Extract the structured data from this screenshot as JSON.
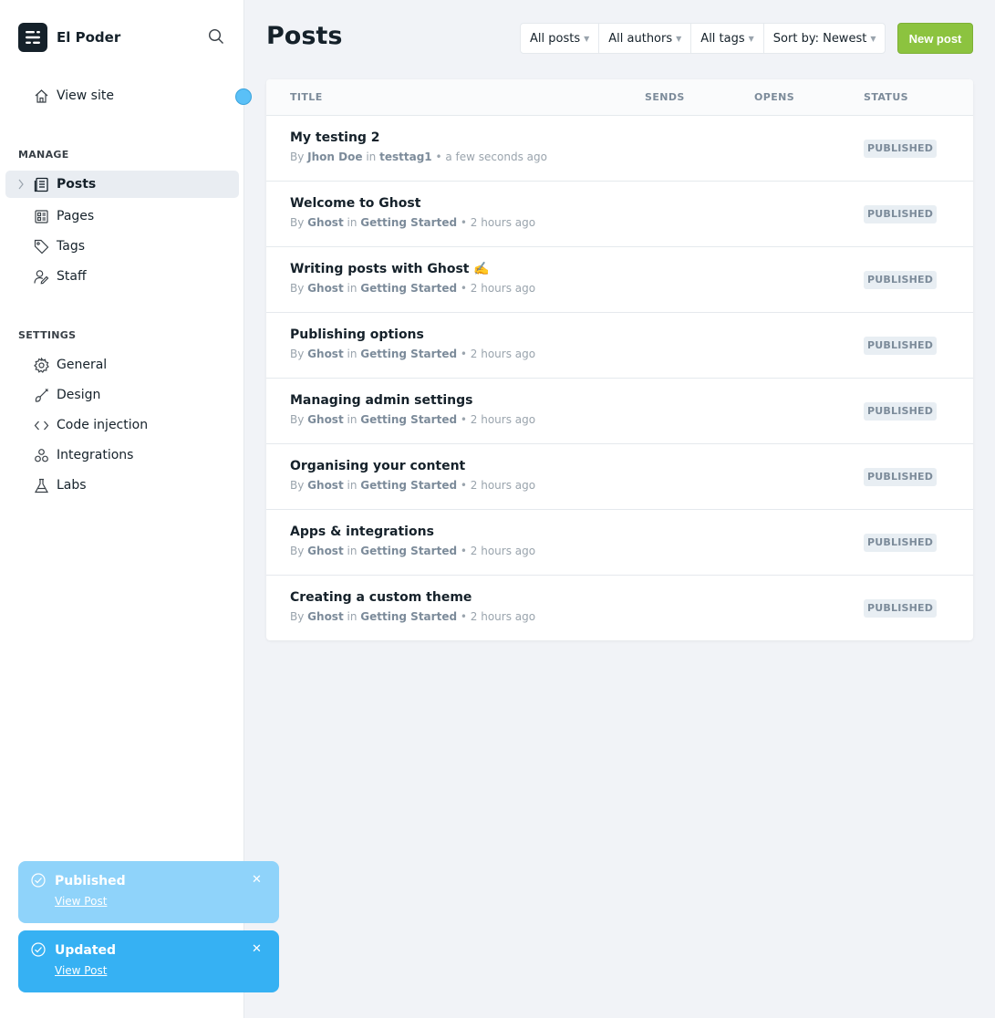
{
  "brand": {
    "name": "El Poder"
  },
  "sidebar": {
    "view_site": "View site",
    "manage_title": "MANAGE",
    "manage": [
      {
        "label": "Posts",
        "icon": "posts-icon",
        "active": true
      },
      {
        "label": "Pages",
        "icon": "pages-icon"
      },
      {
        "label": "Tags",
        "icon": "tag-icon"
      },
      {
        "label": "Staff",
        "icon": "staff-icon"
      }
    ],
    "settings_title": "SETTINGS",
    "settings": [
      {
        "label": "General",
        "icon": "gear-icon"
      },
      {
        "label": "Design",
        "icon": "brush-icon"
      },
      {
        "label": "Code injection",
        "icon": "code-icon"
      },
      {
        "label": "Integrations",
        "icon": "integrations-icon"
      },
      {
        "label": "Labs",
        "icon": "flask-icon"
      }
    ]
  },
  "header": {
    "title": "Posts",
    "filters": [
      "All posts",
      "All authors",
      "All tags",
      "Sort by: Newest"
    ],
    "new_post": "New post"
  },
  "table": {
    "columns": [
      "TITLE",
      "SENDS",
      "OPENS",
      "STATUS"
    ],
    "rows": [
      {
        "title": "My testing 2",
        "by": "By",
        "author": "Jhon Doe",
        "in": "in",
        "tag": "testtag1",
        "time": "• a few seconds ago",
        "status": "PUBLISHED"
      },
      {
        "title": "Welcome to Ghost",
        "by": "By",
        "author": "Ghost",
        "in": "in",
        "tag": "Getting Started",
        "time": "• 2 hours ago",
        "status": "PUBLISHED"
      },
      {
        "title": "Writing posts with Ghost ✍️",
        "by": "By",
        "author": "Ghost",
        "in": "in",
        "tag": "Getting Started",
        "time": "• 2 hours ago",
        "status": "PUBLISHED"
      },
      {
        "title": "Publishing options",
        "by": "By",
        "author": "Ghost",
        "in": "in",
        "tag": "Getting Started",
        "time": "• 2 hours ago",
        "status": "PUBLISHED"
      },
      {
        "title": "Managing admin settings",
        "by": "By",
        "author": "Ghost",
        "in": "in",
        "tag": "Getting Started",
        "time": "• 2 hours ago",
        "status": "PUBLISHED"
      },
      {
        "title": "Organising your content",
        "by": "By",
        "author": "Ghost",
        "in": "in",
        "tag": "Getting Started",
        "time": "• 2 hours ago",
        "status": "PUBLISHED"
      },
      {
        "title": "Apps & integrations",
        "by": "By",
        "author": "Ghost",
        "in": "in",
        "tag": "Getting Started",
        "time": "• 2 hours ago",
        "status": "PUBLISHED"
      },
      {
        "title": "Creating a custom theme",
        "by": "By",
        "author": "Ghost",
        "in": "in",
        "tag": "Getting Started",
        "time": "• 2 hours ago",
        "status": "PUBLISHED"
      }
    ]
  },
  "toasts": [
    {
      "title": "Published",
      "link": "View Post"
    },
    {
      "title": "Updated",
      "link": "View Post"
    }
  ],
  "colors": {
    "accent": "#8cc33f",
    "toast": "#36b1f3",
    "sidebar_active": "#e9edf2"
  }
}
